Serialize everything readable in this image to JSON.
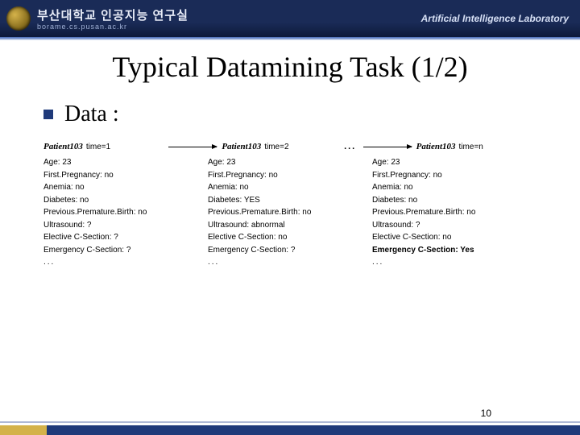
{
  "header": {
    "university": "부산대학교 인공지능 연구실",
    "url": "borame.cs.pusan.ac.kr",
    "lab": "Artificial Intelligence Laboratory"
  },
  "title": "Typical Datamining Task (1/2)",
  "bullet": "Data :",
  "timeline": {
    "patient": "Patient103",
    "t1": "time=1",
    "t2": "time=2",
    "tn": "time=n",
    "dots": "..."
  },
  "records": [
    {
      "age": "Age: 23",
      "fp": "First.Pregnancy: no",
      "an": "Anemia: no",
      "db": "Diabetes: no",
      "pp": "Previous.Premature.Birth: no",
      "us": "Ultrasound: ?",
      "ec": "Elective C-Section: ?",
      "em": "Emergency C-Section: ?",
      "em_bold": false,
      "dots": "..."
    },
    {
      "age": "Age: 23",
      "fp": "First.Pregnancy: no",
      "an": "Anemia: no",
      "db": "Diabetes: YES",
      "pp": "Previous.Premature.Birth: no",
      "us": "Ultrasound: abnormal",
      "ec": "Elective C-Section: no",
      "em": "Emergency C-Section: ?",
      "em_bold": false,
      "dots": "..."
    },
    {
      "age": "Age: 23",
      "fp": "First.Pregnancy: no",
      "an": "Anemia: no",
      "db": "Diabetes: no",
      "pp": "Previous.Premature.Birth: no",
      "us": "Ultrasound: ?",
      "ec": "Elective C-Section: no",
      "em": "Emergency C-Section:  Yes",
      "em_bold": true,
      "dots": "..."
    }
  ],
  "page": "10"
}
